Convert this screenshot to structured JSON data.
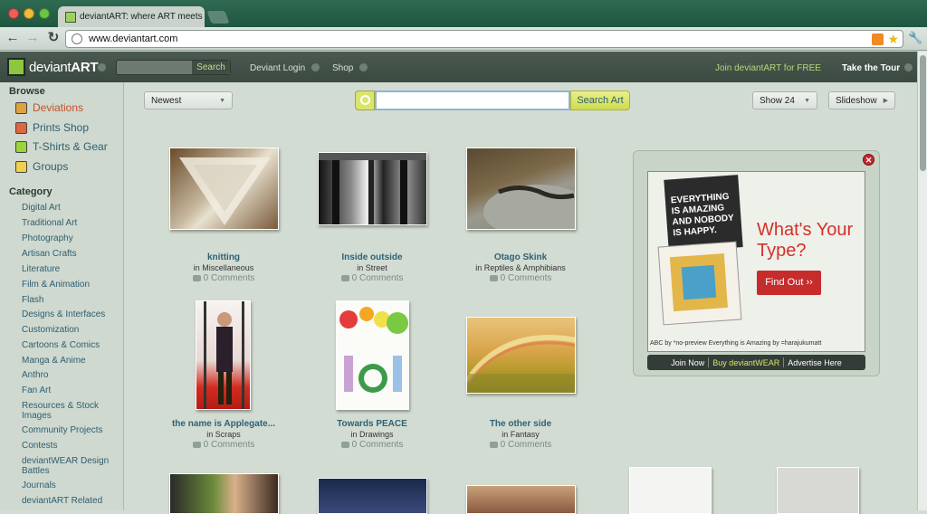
{
  "browser": {
    "tab_title": "deviantART: where ART meets application!",
    "url": "www.deviantart.com"
  },
  "header": {
    "logo_prefix": "deviant",
    "logo_suffix": "ART",
    "search_button": "Search",
    "login": "Deviant Login",
    "shop": "Shop",
    "join": "Join deviantART for FREE",
    "tour": "Take the Tour"
  },
  "sidebar": {
    "browse_heading": "Browse",
    "main_items": [
      {
        "label": "Deviations",
        "icon": "deviations-icon"
      },
      {
        "label": "Prints Shop",
        "icon": "prints-icon"
      },
      {
        "label": "T-Shirts & Gear",
        "icon": "tshirt-icon"
      },
      {
        "label": "Groups",
        "icon": "groups-icon"
      }
    ],
    "category_heading": "Category",
    "categories": [
      "Digital Art",
      "Traditional Art",
      "Photography",
      "Artisan Crafts",
      "Literature",
      "Film & Animation",
      "Flash",
      "Designs & Interfaces",
      "Customization",
      "Cartoons & Comics",
      "Manga & Anime",
      "Anthro",
      "Fan Art",
      "Resources & Stock Images",
      "Community Projects",
      "Contests",
      "deviantWEAR Design Battles",
      "Journals",
      "deviantART Related"
    ]
  },
  "controls": {
    "sort": "Newest",
    "search_button": "Search Art",
    "show": "Show 24",
    "slideshow": "Slideshow"
  },
  "deviations": [
    {
      "title": "knitting",
      "in": "in",
      "category": "Miscellaneous",
      "comments": "0 Comments"
    },
    {
      "title": "Inside outside",
      "in": "in",
      "category": "Street",
      "comments": "0 Comments"
    },
    {
      "title": "Otago Skink",
      "in": "in",
      "category": "Reptiles & Amphibians",
      "comments": "0 Comments"
    },
    {
      "title": "the name is Applegate...",
      "in": "in",
      "category": "Scraps",
      "comments": "0 Comments"
    },
    {
      "title": "Towards PEACE",
      "in": "in",
      "category": "Drawings",
      "comments": "0 Comments"
    },
    {
      "title": "The other side",
      "in": "in",
      "category": "Fantasy",
      "comments": "0 Comments"
    }
  ],
  "ad": {
    "poster_text": "EVERYTHING IS AMAZING AND NOBODY IS HAPPY.",
    "headline": "What's Your Type?",
    "cta": "Find Out ››",
    "credit": "ABC by *no-preview   Everything is Amazing by =harajukumatt",
    "bar_join": "Join Now",
    "bar_buy": "Buy deviantWEAR",
    "bar_advertise": "Advertise Here"
  },
  "colors": {
    "brand_green": "#8dc63f",
    "link": "#2f5e71",
    "active": "#c5512b",
    "ad_red": "#c62c2c"
  }
}
